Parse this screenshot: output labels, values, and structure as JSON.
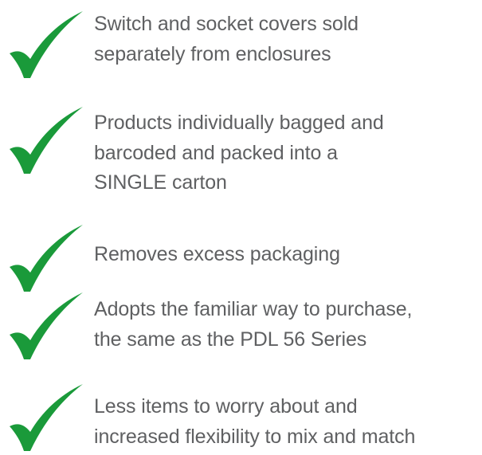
{
  "icon": {
    "name": "checkmark-icon",
    "color": "#1a9a3a"
  },
  "items": [
    {
      "text": "Switch and socket covers sold\nseparately from enclosures"
    },
    {
      "text": "Products individually bagged and\nbarcoded and packed into a\nSINGLE carton"
    },
    {
      "text": "Removes excess packaging"
    },
    {
      "text": "Adopts the familiar way to purchase,\nthe same as the PDL 56 Series"
    },
    {
      "text": "Less items to worry about and\nincreased flexibility to mix and match"
    }
  ]
}
